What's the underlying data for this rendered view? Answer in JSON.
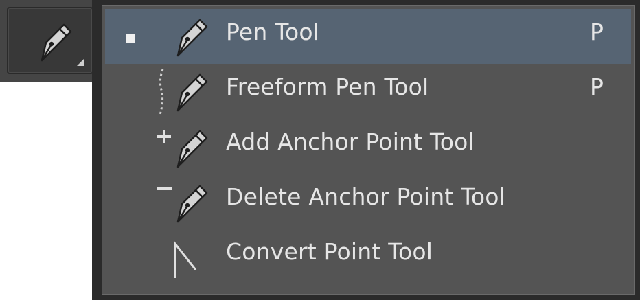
{
  "toolbar": {
    "active_tool_icon": "pen-icon",
    "flyout_indicator": "flyout-triangle-icon"
  },
  "menu": {
    "items": [
      {
        "label": "Pen Tool",
        "shortcut": "P",
        "icon": "pen-icon",
        "selected": true
      },
      {
        "label": "Freeform Pen Tool",
        "shortcut": "P",
        "icon": "freeform-pen-icon",
        "selected": false
      },
      {
        "label": "Add Anchor Point Tool",
        "shortcut": "",
        "icon": "add-anchor-point-icon",
        "selected": false
      },
      {
        "label": "Delete Anchor Point Tool",
        "shortcut": "",
        "icon": "delete-anchor-point-icon",
        "selected": false
      },
      {
        "label": "Convert Point Tool",
        "shortcut": "",
        "icon": "convert-point-icon",
        "selected": false
      }
    ]
  },
  "colors": {
    "menu_background": "#545454",
    "selected_background": "#566473",
    "text": "#e6e6e6",
    "toolbar_background": "#454545"
  }
}
